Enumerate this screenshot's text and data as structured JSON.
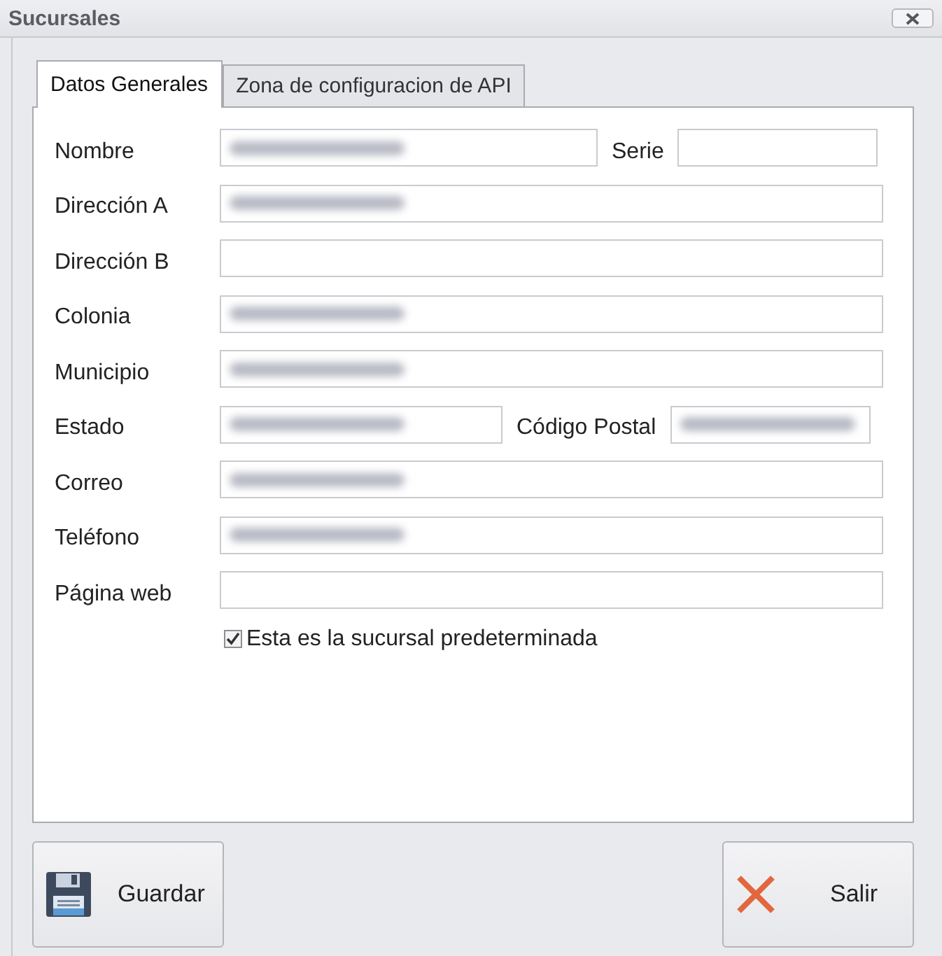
{
  "window": {
    "title": "Sucursales"
  },
  "tabs": [
    {
      "label": "Datos Generales",
      "selected": true
    },
    {
      "label": "Zona de configuracion de API",
      "selected": false
    }
  ],
  "rows": [
    {
      "label": "Nombre",
      "blurred": true,
      "extra": {
        "label": "Serie",
        "blurred": false
      }
    },
    {
      "label": "Dirección A",
      "blurred": true
    },
    {
      "label": "Dirección B",
      "blurred": false
    },
    {
      "label": "Colonia",
      "blurred": true
    },
    {
      "label": "Municipio",
      "blurred": true
    },
    {
      "label": "Estado",
      "blurred": true,
      "extra": {
        "label": "Código Postal",
        "blurred": true
      }
    },
    {
      "label": "Correo",
      "blurred": true
    },
    {
      "label": "Teléfono",
      "blurred": true
    },
    {
      "label": "Página web",
      "blurred": false
    }
  ],
  "default_checkbox": {
    "label": "Esta es la sucursal predeterminada",
    "checked": true
  },
  "buttons": [
    {
      "kind": "save",
      "label": "Guardar"
    },
    {
      "kind": "exit",
      "label": "Salir"
    }
  ]
}
